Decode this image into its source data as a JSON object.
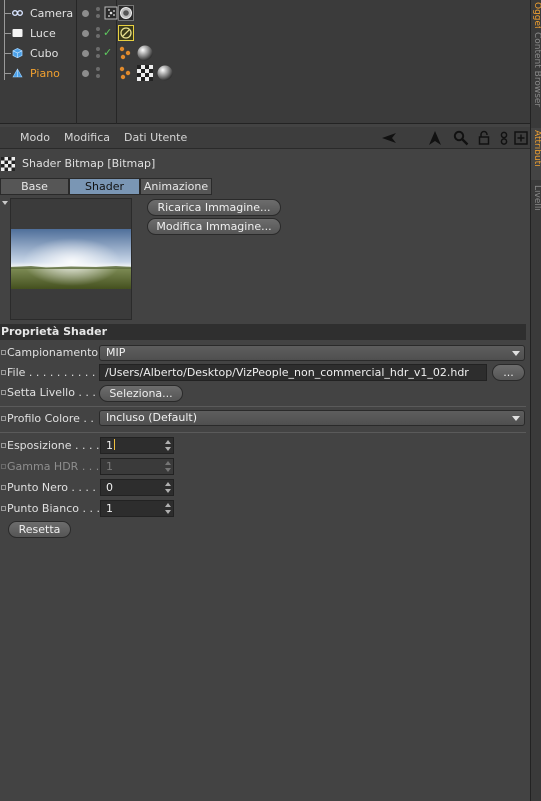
{
  "object_manager": {
    "objects": [
      {
        "name": "Camera",
        "type": "camera",
        "selected": false
      },
      {
        "name": "Luce",
        "type": "light",
        "selected": false
      },
      {
        "name": "Cubo",
        "type": "cube",
        "selected": false
      },
      {
        "name": "Piano",
        "type": "plane",
        "selected": true
      }
    ]
  },
  "side_tabs": [
    "Oggetti",
    "Content Browser",
    "Attributi",
    "Livelli"
  ],
  "menu": {
    "items": [
      "Modo",
      "Modifica",
      "Dati Utente"
    ],
    "toolbar_icons": [
      "back-arrow-icon",
      "up-arrow-icon",
      "search-icon",
      "lock-icon",
      "link-icon",
      "new-panel-icon"
    ]
  },
  "header": {
    "icon": "checker-shader-icon",
    "title": "Shader Bitmap [Bitmap]"
  },
  "tabs": [
    {
      "label": "Base",
      "active": false
    },
    {
      "label": "Shader",
      "active": true
    },
    {
      "label": "Animazione",
      "active": false
    }
  ],
  "preview": {
    "reload_button": "Ricarica Immagine...",
    "edit_button": "Modifica Immagine..."
  },
  "section_title": "Proprietà Shader",
  "properties": {
    "campionamento": {
      "label": "Campionamento",
      "value": "MIP"
    },
    "file": {
      "label": "File . . . . . . . . . . .",
      "value": "/Users/Alberto/Desktop/VizPeople_non_commercial_hdr_v1_02.hdr",
      "browse": "..."
    },
    "setta_livello": {
      "label": "Setta Livello . . . .",
      "button": "Seleziona..."
    },
    "profilo_colore": {
      "label": "Profilo Colore . .",
      "value": "Incluso (Default)"
    },
    "esposizione": {
      "label": "Esposizione . . . .",
      "value": "1"
    },
    "gamma_hdr": {
      "label": "Gamma HDR . . . .",
      "value": "1"
    },
    "punto_nero": {
      "label": "Punto Nero . . . . .",
      "value": "0"
    },
    "punto_bianco": {
      "label": "Punto Bianco . . .",
      "value": "1"
    },
    "reset_button": "Resetta"
  },
  "colors": {
    "selection_orange": "#f0a030",
    "active_tab": "#7a96b4",
    "check_green": "#5ec85e"
  }
}
